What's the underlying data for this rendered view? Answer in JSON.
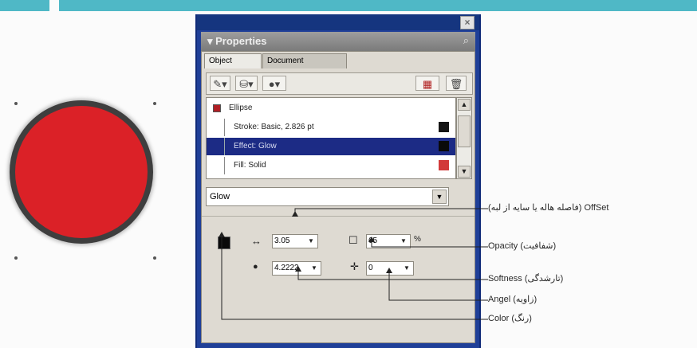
{
  "panel": {
    "title": "▾ Properties",
    "close_glyph": "×",
    "options_glyph": "⌕",
    "tabs": [
      {
        "label": "Object"
      },
      {
        "label": "Document"
      }
    ],
    "toolbar": {
      "stroke_btn": "✎▾",
      "fill_btn": "⛁▾",
      "effect_btn": "●▾",
      "layer_btn": "▦",
      "delete_btn": "🗑"
    },
    "attributes": [
      {
        "label": "Ellipse"
      },
      {
        "label": "Stroke: Basic, 2.826 pt"
      },
      {
        "label": "Effect: Glow"
      },
      {
        "label": "Fill: Solid"
      }
    ],
    "effect_select": "Glow",
    "offset_value": "3.05",
    "opacity_value": "65",
    "opacity_unit": "%",
    "softness_value": "4.2222",
    "angle_value": "0"
  },
  "annotations": {
    "offset": "(فاصله هاله یا سایه از لبه) OffSet",
    "opacity": "Opacity  (شفافیت)",
    "softness": "Softness (تارشدگی)",
    "angle": "Angel (زاویه)",
    "color": "Color (رنگ)"
  },
  "colors": {
    "circle_fill": "#db2127",
    "circle_stroke": "#3e3e3e",
    "window_frame": "#1f3f98",
    "selection": "#1c2b85",
    "accent_bar": "#4fb8c6"
  }
}
